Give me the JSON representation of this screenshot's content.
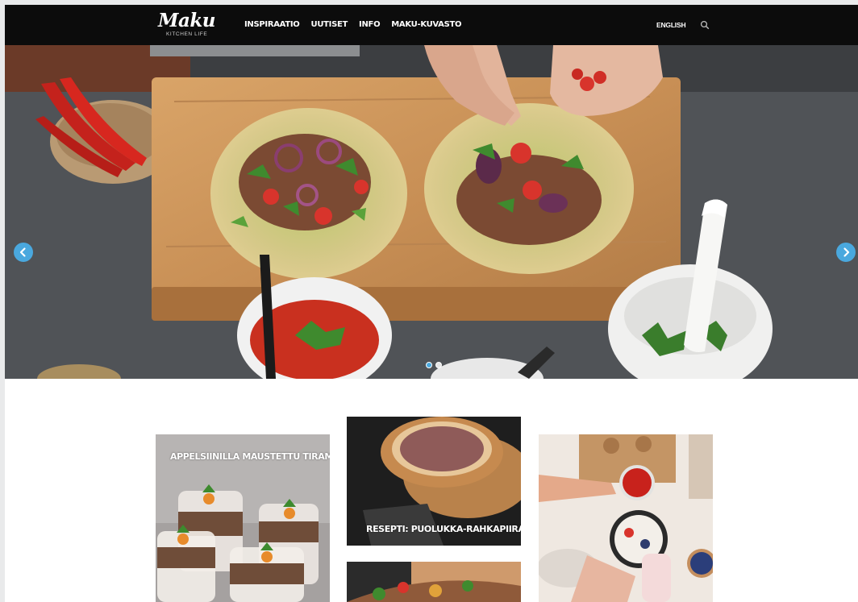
{
  "header": {
    "logo": "Maku",
    "logo_tagline": "KITCHEN LIFE",
    "nav": [
      {
        "label": "INSPIRAATIO"
      },
      {
        "label": "UUTISET"
      },
      {
        "label": "INFO"
      },
      {
        "label": "MAKU-KUVASTO"
      }
    ],
    "language": "ENGLISH",
    "search_icon": "search-icon"
  },
  "hero": {
    "slides": 2,
    "active_slide": 1,
    "prev_icon": "chevron-left-icon",
    "next_icon": "chevron-right-icon"
  },
  "cards": [
    {
      "title": "APPELSIINILLA MAUSTETTU TIRAMISU"
    },
    {
      "title": "RESEPTI: PUOLUKKA-RAHKAPIIRAS"
    },
    {
      "title": ""
    },
    {
      "title": ""
    }
  ],
  "colors": {
    "header_bg": "#0c0c0c",
    "accent": "#4aa8de",
    "page_bg": "#ffffff"
  }
}
